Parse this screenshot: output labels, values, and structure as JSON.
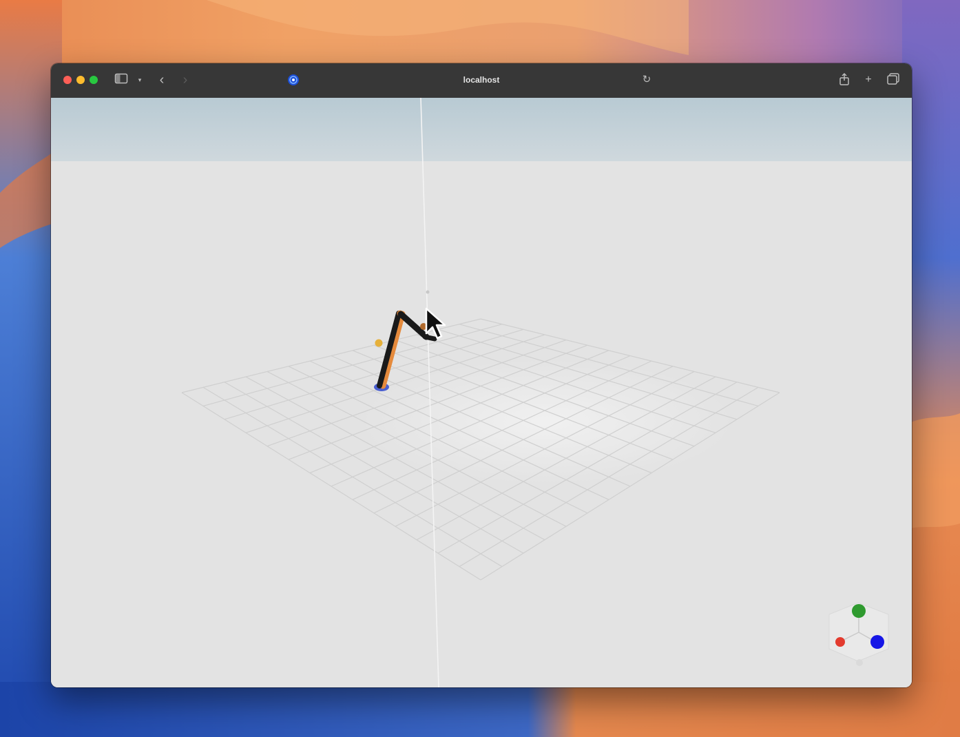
{
  "browser": {
    "url": "localhost",
    "icons": {
      "sidebar": "sidebar-toggle-icon",
      "sidebar_menu": "chevron-down-icon",
      "back": "chevron-left-icon",
      "forward": "chevron-right-icon",
      "site": "compass-icon",
      "reload": "reload-icon",
      "share": "share-icon",
      "new_tab": "plus-icon",
      "tab_overview": "tabs-overview-icon"
    }
  },
  "viewport": {
    "sky_color": "#c5d3da",
    "floor_color": "#e3e3e3",
    "grid_color": "#cfcfcf"
  },
  "robot_arm": {
    "link_color": "#1a1a1a",
    "accent_color": "#e58a3c",
    "base_color": "#4a5fd0",
    "target_color": "#e6b03a"
  },
  "axis_gizmo": {
    "x_color": "#e33b2e",
    "y_color": "#2f9a2f",
    "z_color": "#1616e6"
  }
}
